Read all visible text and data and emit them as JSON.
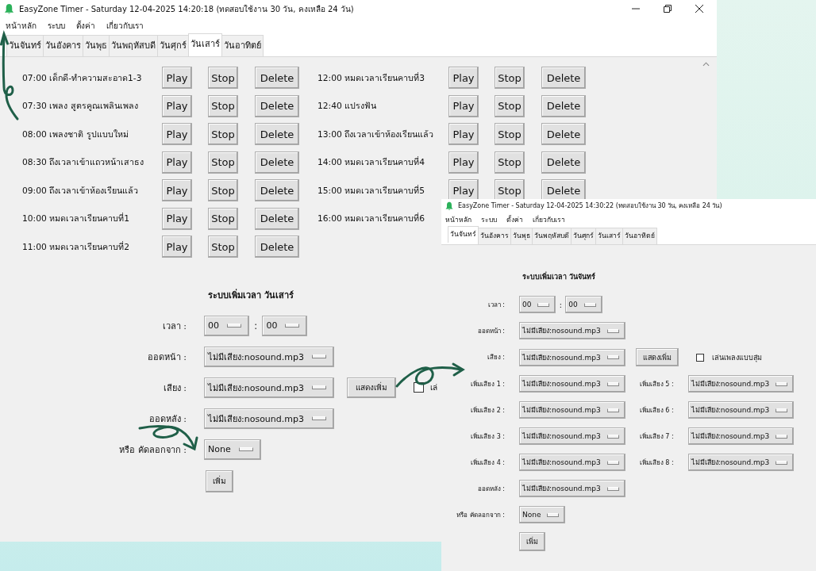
{
  "windows": [
    {
      "title": "EasyZone Timer - Saturday 12-04-2025 14:20:18 (ทดสอบใช้งาน 30 วัน, คงเหลือ 24 วัน)",
      "window_controls": true,
      "scrollbar": true,
      "menu": [
        "หน้าหลัก",
        "ระบบ",
        "ตั้งค่า",
        "เกี่ยวกับเรา"
      ],
      "tabs": [
        {
          "label": "วันจันทร์",
          "selected": false
        },
        {
          "label": "วันอังคาร",
          "selected": false
        },
        {
          "label": "วันพุธ",
          "selected": false
        },
        {
          "label": "วันพฤหัสบดี",
          "selected": false
        },
        {
          "label": "วันศุกร์",
          "selected": false
        },
        {
          "label": "วันเสาร์",
          "selected": true
        },
        {
          "label": "วันอาทิตย์",
          "selected": false
        }
      ],
      "schedule": [
        [
          {
            "label": "07:00 เด็กดี-ทำความสะอาด1-3",
            "buttons": [
              "Play",
              "Stop",
              "Delete"
            ]
          },
          {
            "label": "07:30 เพลง สูตรคูณเพลินเพลง",
            "buttons": [
              "Play",
              "Stop",
              "Delete"
            ]
          },
          {
            "label": "08:00 เพลงชาติ รูปแบบใหม่",
            "buttons": [
              "Play",
              "Stop",
              "Delete"
            ]
          },
          {
            "label": "08:30 ถึงเวลาเข้าแถวหน้าเสาธง",
            "buttons": [
              "Play",
              "Stop",
              "Delete"
            ]
          },
          {
            "label": "09:00 ถึงเวลาเข้าห้องเรียนแล้ว",
            "buttons": [
              "Play",
              "Stop",
              "Delete"
            ]
          },
          {
            "label": "10:00 หมดเวลาเรียนคาบที่1",
            "buttons": [
              "Play",
              "Stop",
              "Delete"
            ]
          },
          {
            "label": "11:00 หมดเวลาเรียนคาบที่2",
            "buttons": [
              "Play",
              "Stop",
              "Delete"
            ]
          }
        ],
        [
          {
            "label": "12:00 หมดเวลาเรียนคาบที่3",
            "buttons": [
              "Play",
              "Stop",
              "Delete"
            ]
          },
          {
            "label": "12:40 แปรงฟัน",
            "buttons": [
              "Play",
              "Stop",
              "Delete"
            ]
          },
          {
            "label": "13:00 ถึงเวลาเข้าห้องเรียนแล้ว",
            "buttons": [
              "Play",
              "Stop",
              "Delete"
            ]
          },
          {
            "label": "14:00 หมดเวลาเรียนคาบที่4",
            "buttons": [
              "Play",
              "Stop",
              "Delete"
            ]
          },
          {
            "label": "15:00 หมดเวลาเรียนคาบที่5",
            "buttons": [
              "Play",
              "Stop",
              "Delete"
            ]
          },
          {
            "label": "16:00 หมดเวลาเรียนคาบที่6"
          }
        ]
      ],
      "form": {
        "heading": "ระบบเพิ่มเวลา วันเสาร์",
        "rows": [
          {
            "kind": "time",
            "label": "เวลา :",
            "hour": "00",
            "separator": ":",
            "minute": "00"
          },
          {
            "kind": "combo",
            "label": "ออดหน้า :",
            "value": "ไม่มีเสียง:nosound.mp3"
          },
          {
            "kind": "combo",
            "label": "เสียง :",
            "value": "ไม่มีเสียง:nosound.mp3",
            "button": "แสดงเพิ่ม",
            "checkbox": {
              "label": "เล่",
              "checked": false
            }
          },
          {
            "kind": "combo",
            "label": "ออดหลัง :",
            "value": "ไม่มีเสียง:nosound.mp3"
          },
          {
            "kind": "combo",
            "label": "หรือ คัดลอกจาก :",
            "value": "None"
          }
        ],
        "submit": "เพิ่ม"
      }
    },
    {
      "title": "EasyZone Timer - Saturday 12-04-2025 14:30:22 (ทดสอบใช้งาน 30 วัน, คงเหลือ 24 วัน)",
      "window_controls": false,
      "scrollbar": false,
      "menu": [
        "หน้าหลัก",
        "ระบบ",
        "ตั้งค่า",
        "เกี่ยวกับเรา"
      ],
      "tabs": [
        {
          "label": "วันจันทร์",
          "selected": true
        },
        {
          "label": "วันอังคาร",
          "selected": false
        },
        {
          "label": "วันพุธ",
          "selected": false
        },
        {
          "label": "วันพฤหัสบดี",
          "selected": false
        },
        {
          "label": "วันศุกร์",
          "selected": false
        },
        {
          "label": "วันเสาร์",
          "selected": false
        },
        {
          "label": "วันอาทิตย์",
          "selected": false
        }
      ],
      "form": {
        "heading": "ระบบเพิ่มเวลา วันจันทร์",
        "rows": [
          {
            "kind": "time",
            "label": "เวลา :",
            "hour": "00",
            "separator": ":",
            "minute": "00"
          },
          {
            "kind": "combo",
            "label": "ออดหน้า :",
            "value": "ไม่มีเสียง:nosound.mp3"
          },
          {
            "kind": "combo",
            "label": "เสียง :",
            "value": "ไม่มีเสียง:nosound.mp3",
            "button": "แสดงเพิ่ม",
            "checkbox": {
              "label": "เล่นเพลงแบบสุ่ม",
              "checked": false
            }
          },
          {
            "kind": "pair",
            "items": [
              {
                "label": "เพิ่มเสียง 1 :",
                "value": "ไม่มีเสียง:nosound.mp3"
              },
              {
                "label": "เพิ่มเสียง 5 :",
                "value": "ไม่มีเสียง:nosound.mp3"
              }
            ]
          },
          {
            "kind": "pair",
            "items": [
              {
                "label": "เพิ่มเสียง 2 :",
                "value": "ไม่มีเสียง:nosound.mp3"
              },
              {
                "label": "เพิ่มเสียง 6 :",
                "value": "ไม่มีเสียง:nosound.mp3"
              }
            ]
          },
          {
            "kind": "pair",
            "items": [
              {
                "label": "เพิ่มเสียง 3 :",
                "value": "ไม่มีเสียง:nosound.mp3"
              },
              {
                "label": "เพิ่มเสียง 7 :",
                "value": "ไม่มีเสียง:nosound.mp3"
              }
            ]
          },
          {
            "kind": "pair",
            "items": [
              {
                "label": "เพิ่มเสียง 4 :",
                "value": "ไม่มีเสียง:nosound.mp3"
              },
              {
                "label": "เพิ่มเสียง 8 :",
                "value": "ไม่มีเสียง:nosound.mp3"
              }
            ]
          },
          {
            "kind": "combo",
            "label": "ออดหลัง :",
            "value": "ไม่มีเสียง:nosound.mp3"
          },
          {
            "kind": "combo",
            "label": "หรือ คัดลอกจาก :",
            "value": "None"
          }
        ],
        "submit": "เพิ่ม"
      }
    }
  ]
}
